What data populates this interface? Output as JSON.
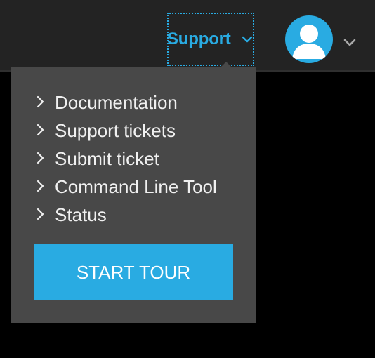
{
  "header": {
    "support_label": "Support",
    "support_chevron_icon": "chevron-down-icon",
    "avatar_icon": "user-icon",
    "avatar_chevron_icon": "chevron-down-icon"
  },
  "support_menu": {
    "items": [
      {
        "label": "Documentation",
        "icon": "chevron-right-icon"
      },
      {
        "label": "Support tickets",
        "icon": "chevron-right-icon"
      },
      {
        "label": "Submit ticket",
        "icon": "chevron-right-icon"
      },
      {
        "label": "Command Line Tool",
        "icon": "chevron-right-icon"
      },
      {
        "label": "Status",
        "icon": "chevron-right-icon"
      }
    ],
    "tour_button_label": "START TOUR"
  },
  "colors": {
    "accent": "#29abe2",
    "topbar_bg": "#232323",
    "menu_bg": "#484848",
    "page_bg": "#000000"
  }
}
